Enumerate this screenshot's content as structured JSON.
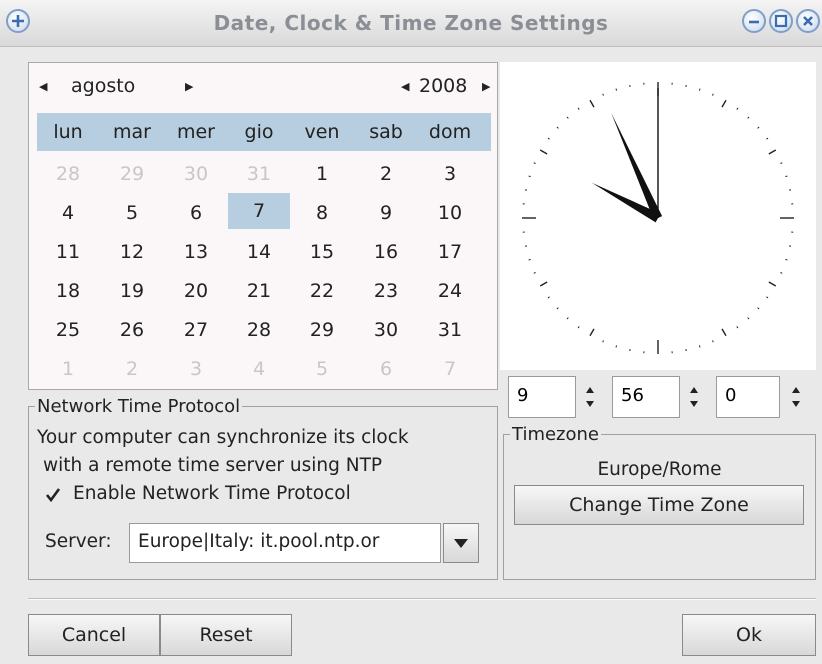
{
  "window": {
    "title": "Date, Clock & Time Zone Settings"
  },
  "calendar": {
    "month": "agosto",
    "year": "2008",
    "weekdays": [
      "lun",
      "mar",
      "mer",
      "gio",
      "ven",
      "sab",
      "dom"
    ],
    "weeks": [
      [
        "28",
        "29",
        "30",
        "31",
        "1",
        "2",
        "3"
      ],
      [
        "4",
        "5",
        "6",
        "7",
        "8",
        "9",
        "10"
      ],
      [
        "11",
        "12",
        "13",
        "14",
        "15",
        "16",
        "17"
      ],
      [
        "18",
        "19",
        "20",
        "21",
        "22",
        "23",
        "24"
      ],
      [
        "25",
        "26",
        "27",
        "28",
        "29",
        "30",
        "31"
      ],
      [
        "1",
        "2",
        "3",
        "4",
        "5",
        "6",
        "7"
      ]
    ],
    "selected_day": "7"
  },
  "clock": {
    "hour": "9",
    "minute": "56",
    "second": "0"
  },
  "timezone": {
    "legend": "Timezone",
    "current": "Europe/Rome",
    "change_label": "Change Time Zone"
  },
  "ntp": {
    "legend": "Network Time Protocol",
    "desc_line1": "Your computer can synchronize its clock",
    "desc_line2": "with a remote time server using NTP",
    "enable_label": "Enable Network Time Protocol",
    "enabled": true,
    "server_label": "Server:",
    "server_value": "Europe|Italy: it.pool.ntp.or"
  },
  "buttons": {
    "cancel": "Cancel",
    "reset": "Reset",
    "ok": "Ok"
  },
  "icons": {
    "window_menu": "plus-icon",
    "minimize": "minimize-icon",
    "maximize": "maximize-icon",
    "close": "close-icon"
  },
  "colors": {
    "accent": "#b7cde0",
    "window_bg": "#e9e9e9"
  }
}
